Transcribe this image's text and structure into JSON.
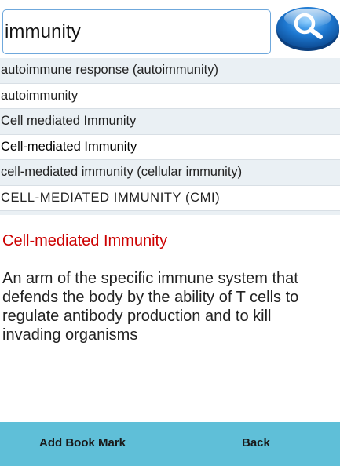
{
  "search": {
    "value": "immunity",
    "button_icon": "magnifier-icon"
  },
  "suggestions": [
    {
      "label": "autoimmune response (autoimmunity)"
    },
    {
      "label": "autoimmunity"
    },
    {
      "label": "Cell mediated Immunity"
    },
    {
      "label": "Cell-mediated Immunity"
    },
    {
      "label": "cell-mediated immunity (cellular immunity)"
    },
    {
      "label": "CELL-MEDIATED IMMUNITY (CMI)"
    }
  ],
  "entry": {
    "title": "Cell-mediated Immunity",
    "definition": "An arm of the specific immune system that defends the body by the ability of T cells to regulate antibody production and to kill invading organisms"
  },
  "bottom_bar": {
    "bookmark_label": "Add Book Mark",
    "back_label": "Back"
  },
  "colors": {
    "title_red": "#cc0000",
    "bottom_bar": "#5fbfd8",
    "row_alt": "#eaf0f4",
    "search_button": "#1e78d0"
  }
}
